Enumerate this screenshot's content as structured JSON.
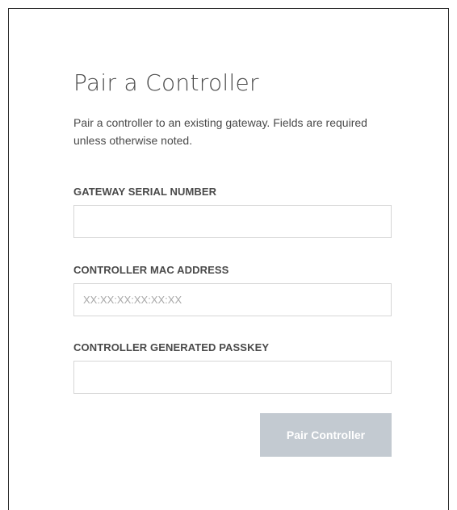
{
  "form": {
    "title": "Pair a Controller",
    "intro": "Pair a controller to an existing gateway. Fields are required unless otherwise noted.",
    "fields": [
      {
        "label": "GATEWAY SERIAL NUMBER",
        "value": "",
        "placeholder": ""
      },
      {
        "label": "CONTROLLER MAC ADDRESS",
        "value": "",
        "placeholder": "XX:XX:XX:XX:XX:XX"
      },
      {
        "label": "CONTROLLER GENERATED PASSKEY",
        "value": "",
        "placeholder": ""
      }
    ],
    "submit_label": "Pair Controller",
    "submit_enabled": false
  },
  "colors": {
    "button_disabled_bg": "#c3cad1",
    "input_border": "#d6d6d6",
    "text": "#4a4a4a"
  }
}
